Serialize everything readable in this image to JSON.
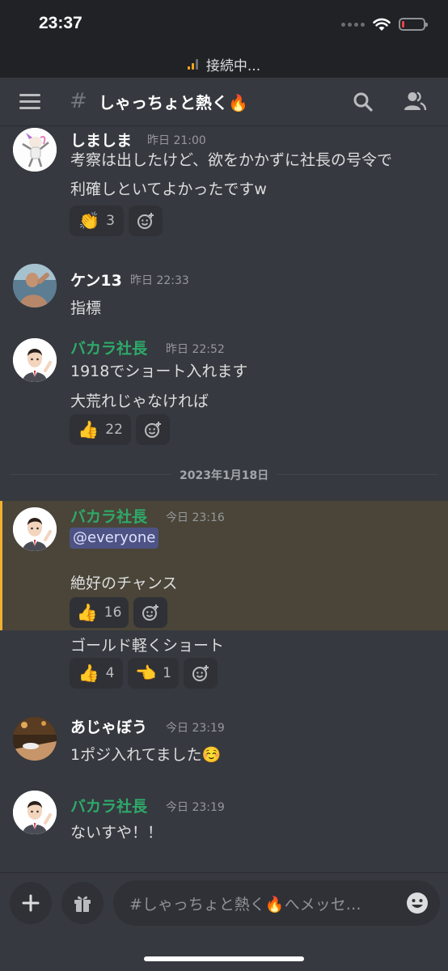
{
  "status_bar": {
    "time": "23:37"
  },
  "connection": {
    "text": "接続中..."
  },
  "header": {
    "hash": "#",
    "channel_name": "しゃっちょと熱く🔥"
  },
  "messages": [
    {
      "author": "しましま",
      "time": "昨日 21:00",
      "lines": [
        "考察は出したけど、欲をかかずに社長の号令で",
        "利確しといてよかったですw"
      ],
      "reactions": [
        {
          "emoji": "👏",
          "count": "3"
        }
      ]
    },
    {
      "author": "ケン13",
      "time": "昨日 22:33",
      "lines": [
        "指標"
      ]
    },
    {
      "author": "バカラ社長",
      "time": "昨日 22:52",
      "lines": [
        "1918でショート入れます",
        "大荒れじゃなければ"
      ],
      "reactions": [
        {
          "emoji": "👍",
          "count": "22"
        }
      ]
    },
    {
      "author": "バカラ社長",
      "time": "今日 23:16",
      "mention": "@everyone",
      "lines": [
        "絶好のチャンス"
      ],
      "reactions": [
        {
          "emoji": "👍",
          "count": "16"
        }
      ]
    },
    {
      "lines": [
        "ゴールド軽くショート"
      ],
      "reactions": [
        {
          "emoji": "👍",
          "count": "4"
        },
        {
          "emoji": "👈",
          "count": "1"
        }
      ]
    },
    {
      "author": "あじゃぼう",
      "time": "今日 23:19",
      "lines": [
        "1ポジ入れてました☺️"
      ]
    },
    {
      "author": "バカラ社長",
      "time": "今日 23:19",
      "lines": [
        "ないすや！！"
      ]
    }
  ],
  "date_divider": "2023年1月18日",
  "composer": {
    "placeholder": "#しゃっちょと熱く🔥へメッセ…"
  },
  "colors": {
    "background": "#36393f",
    "accent_green": "#2ea96a",
    "highlight": "#4a4538",
    "highlight_border": "#f0b132"
  }
}
